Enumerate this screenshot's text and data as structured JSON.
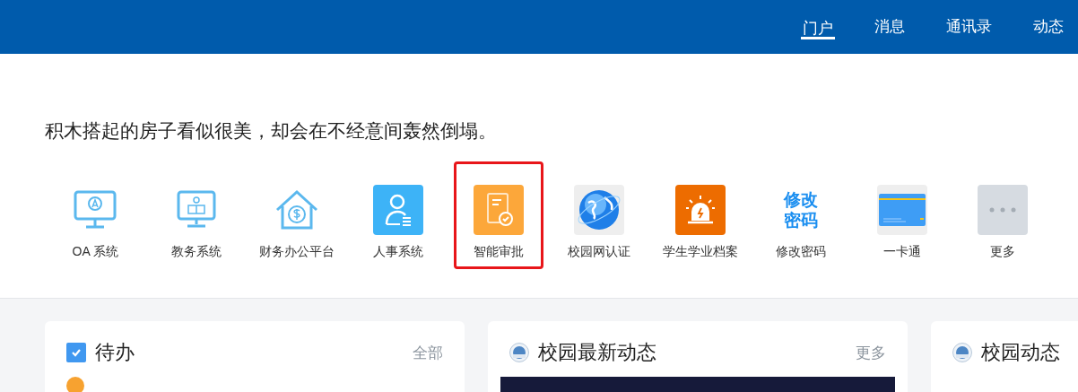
{
  "nav": [
    {
      "label": "门户",
      "selected": true
    },
    {
      "label": "消息",
      "selected": false
    },
    {
      "label": "通讯录",
      "selected": false
    },
    {
      "label": "动态",
      "selected": false
    }
  ],
  "motto": "积木搭起的房子看似很美，却会在不经意间轰然倒塌。",
  "apps": [
    {
      "label": "OA 系统",
      "kind": "monitor-a",
      "highlighted": false
    },
    {
      "label": "教务系统",
      "kind": "monitor-reader",
      "highlighted": false
    },
    {
      "label": "财务办公平台",
      "kind": "house-dollar",
      "highlighted": false
    },
    {
      "label": "人事系统",
      "kind": "person",
      "highlighted": false
    },
    {
      "label": "智能审批",
      "kind": "approval",
      "highlighted": true
    },
    {
      "label": "校园网认证",
      "kind": "globe",
      "highlighted": false
    },
    {
      "label": "学生学业档案",
      "kind": "alarm",
      "highlighted": false
    },
    {
      "label": "修改密码",
      "kind": "text",
      "icon_text": [
        "修改",
        "密码"
      ],
      "highlighted": false
    },
    {
      "label": "一卡通",
      "kind": "card",
      "highlighted": false
    },
    {
      "label": "更多",
      "kind": "more",
      "highlighted": false
    }
  ],
  "cards": [
    {
      "title": "待办",
      "kind": "todo",
      "link": "全部"
    },
    {
      "title": "校园最新动态",
      "kind": "news",
      "link": "更多"
    },
    {
      "title": "校园动态",
      "kind": "feed"
    }
  ]
}
